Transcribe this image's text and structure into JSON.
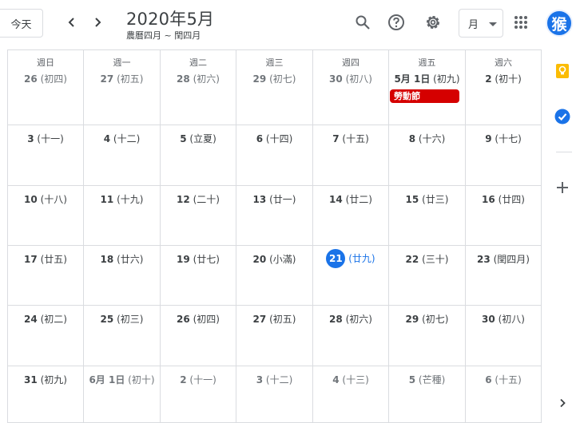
{
  "header": {
    "today_label": "今天",
    "title": "2020年5月",
    "subtitle": "農曆四月 ~ 閏四月",
    "view_label": "月",
    "avatar_text": "猴"
  },
  "icons": {
    "prev": "chevron-left-icon",
    "next": "chevron-right-icon",
    "search": "search-icon",
    "help": "help-icon",
    "settings": "gear-icon",
    "apps": "apps-grid-icon",
    "keep": "keep-bulb-icon",
    "tasks": "tasks-check-icon",
    "add": "plus-icon",
    "expand": "chevron-right-icon"
  },
  "colors": {
    "accent": "#1a73e8",
    "event": "#d50000",
    "keep": "#fbbc04"
  },
  "weekdays": [
    "週日",
    "週一",
    "週二",
    "週三",
    "週四",
    "週五",
    "週六"
  ],
  "weeks": [
    [
      {
        "n": "26",
        "l": "(初四)",
        "other": true
      },
      {
        "n": "27",
        "l": "(初五)",
        "other": true
      },
      {
        "n": "28",
        "l": "(初六)",
        "other": true
      },
      {
        "n": "29",
        "l": "(初七)",
        "other": true
      },
      {
        "n": "30",
        "l": "(初八)",
        "other": true
      },
      {
        "n": "5月 1日",
        "l": "(初九)",
        "event": "勞動節"
      },
      {
        "n": "2",
        "l": "(初十)"
      }
    ],
    [
      {
        "n": "3",
        "l": "(十一)"
      },
      {
        "n": "4",
        "l": "(十二)"
      },
      {
        "n": "5",
        "l": "(立夏)"
      },
      {
        "n": "6",
        "l": "(十四)"
      },
      {
        "n": "7",
        "l": "(十五)"
      },
      {
        "n": "8",
        "l": "(十六)"
      },
      {
        "n": "9",
        "l": "(十七)"
      }
    ],
    [
      {
        "n": "10",
        "l": "(十八)"
      },
      {
        "n": "11",
        "l": "(十九)"
      },
      {
        "n": "12",
        "l": "(二十)"
      },
      {
        "n": "13",
        "l": "(廿一)"
      },
      {
        "n": "14",
        "l": "(廿二)"
      },
      {
        "n": "15",
        "l": "(廿三)"
      },
      {
        "n": "16",
        "l": "(廿四)"
      }
    ],
    [
      {
        "n": "17",
        "l": "(廿五)"
      },
      {
        "n": "18",
        "l": "(廿六)"
      },
      {
        "n": "19",
        "l": "(廿七)"
      },
      {
        "n": "20",
        "l": "(小滿)"
      },
      {
        "n": "21",
        "l": "(廿九)",
        "today": true
      },
      {
        "n": "22",
        "l": "(三十)"
      },
      {
        "n": "23",
        "l": "(閏四月)"
      }
    ],
    [
      {
        "n": "24",
        "l": "(初二)"
      },
      {
        "n": "25",
        "l": "(初三)"
      },
      {
        "n": "26",
        "l": "(初四)"
      },
      {
        "n": "27",
        "l": "(初五)"
      },
      {
        "n": "28",
        "l": "(初六)"
      },
      {
        "n": "29",
        "l": "(初七)"
      },
      {
        "n": "30",
        "l": "(初八)"
      }
    ],
    [
      {
        "n": "31",
        "l": "(初九)"
      },
      {
        "n": "6月 1日",
        "l": "(初十)",
        "other": true
      },
      {
        "n": "2",
        "l": "(十一)",
        "other": true
      },
      {
        "n": "3",
        "l": "(十二)",
        "other": true
      },
      {
        "n": "4",
        "l": "(十三)",
        "other": true
      },
      {
        "n": "5",
        "l": "(芒種)",
        "other": true
      },
      {
        "n": "6",
        "l": "(十五)",
        "other": true
      }
    ]
  ]
}
